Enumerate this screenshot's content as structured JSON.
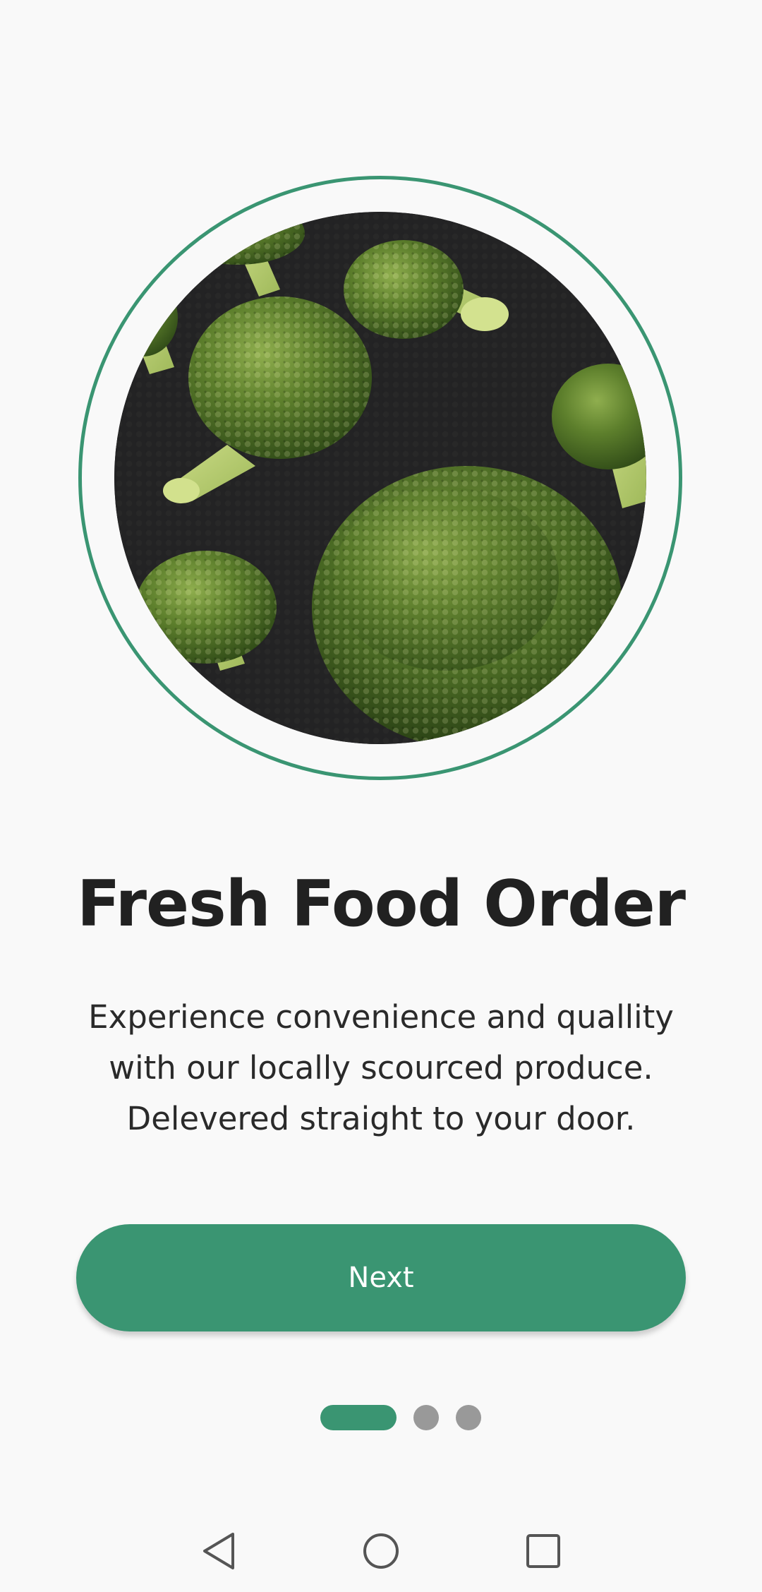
{
  "onboarding": {
    "title": "Fresh Food Order",
    "description_lines": [
      "Experience convenience and quallity",
      "with our locally scourced produce.",
      "Delevered straight to your door."
    ],
    "next_label": "Next",
    "page_indicator": {
      "current_page": 1,
      "total_pages": 3
    }
  },
  "hero_image": {
    "subject": "broccoli florets on dark slate"
  },
  "nav_bar": {
    "back_icon": "triangle-back-icon",
    "home_icon": "circle-home-icon",
    "recents_icon": "square-recents-icon"
  },
  "colors": {
    "accent": "#3a9572",
    "background": "#f9f9f9",
    "title_text": "#212121",
    "body_text": "#2a2a2a",
    "inactive_dot": "#999999"
  }
}
